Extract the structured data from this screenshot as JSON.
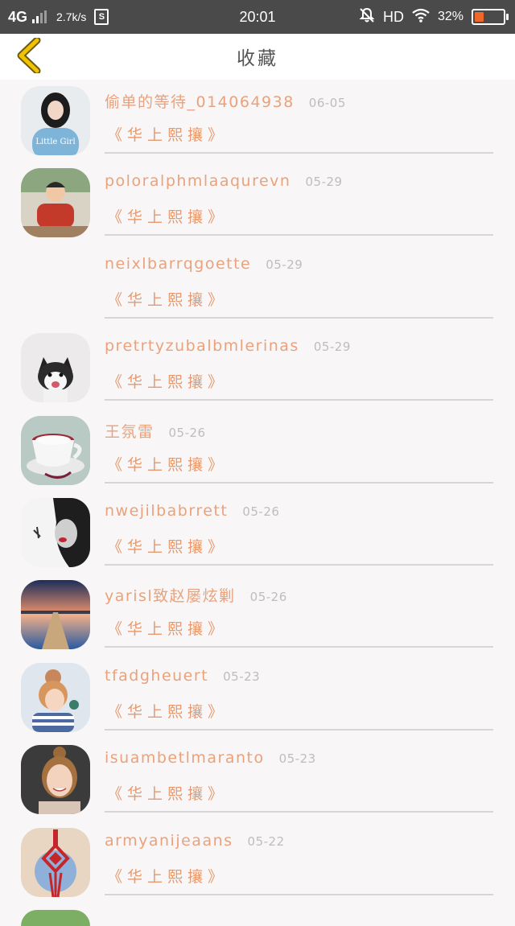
{
  "status_bar": {
    "network": "4G",
    "speed": "2.7k/s",
    "s_badge": "S",
    "time": "20:01",
    "hd": "HD",
    "battery_pct": "32%",
    "battery_level": 0.32,
    "battery_color": "#f0672a"
  },
  "nav": {
    "back_icon": "chevron-left-icon",
    "title": "收藏",
    "back_color": "#f2c200"
  },
  "items": [
    {
      "username": "偷单的等待_014064938",
      "date": "06-05",
      "book": "《华上熙攘》",
      "avatar": "photo-girl-hoodie"
    },
    {
      "username": "poloralphmlaaqurevn",
      "date": "05-29",
      "book": "《华上熙攘》",
      "avatar": "photo-boy-red-shirt"
    },
    {
      "username": "neixlbarrqgoette",
      "date": "05-29",
      "book": "《华上熙攘》",
      "avatar": ""
    },
    {
      "username": "pretrtyzubalbmlerinas",
      "date": "05-29",
      "book": "《华上熙攘》",
      "avatar": "photo-husky-dog"
    },
    {
      "username": "王氛雷",
      "date": "05-26",
      "book": "《华上熙攘》",
      "avatar": "photo-coffee-cup"
    },
    {
      "username": "nwejilbabrrett",
      "date": "05-26",
      "book": "《华上熙攘》",
      "avatar": "photo-bw-woman"
    },
    {
      "username": "yarisl致赵屡炫剿",
      "date": "05-26",
      "book": "《华上熙攘》",
      "avatar": "photo-pier-sunset"
    },
    {
      "username": "tfadgheuert",
      "date": "05-23",
      "book": "《华上熙攘》",
      "avatar": "photo-girl-bun"
    },
    {
      "username": "isuambetlmaranto",
      "date": "05-23",
      "book": "《华上熙攘》",
      "avatar": "photo-smiling-girl"
    },
    {
      "username": "armyanijeaans",
      "date": "05-22",
      "book": "《华上熙攘》",
      "avatar": "photo-chinese-knot"
    }
  ],
  "colors": {
    "username": "#e9a27c",
    "book": "#e59a70",
    "date": "#bdbdbd",
    "divider": "#d6d6d6",
    "background": "#f8f6f6"
  }
}
